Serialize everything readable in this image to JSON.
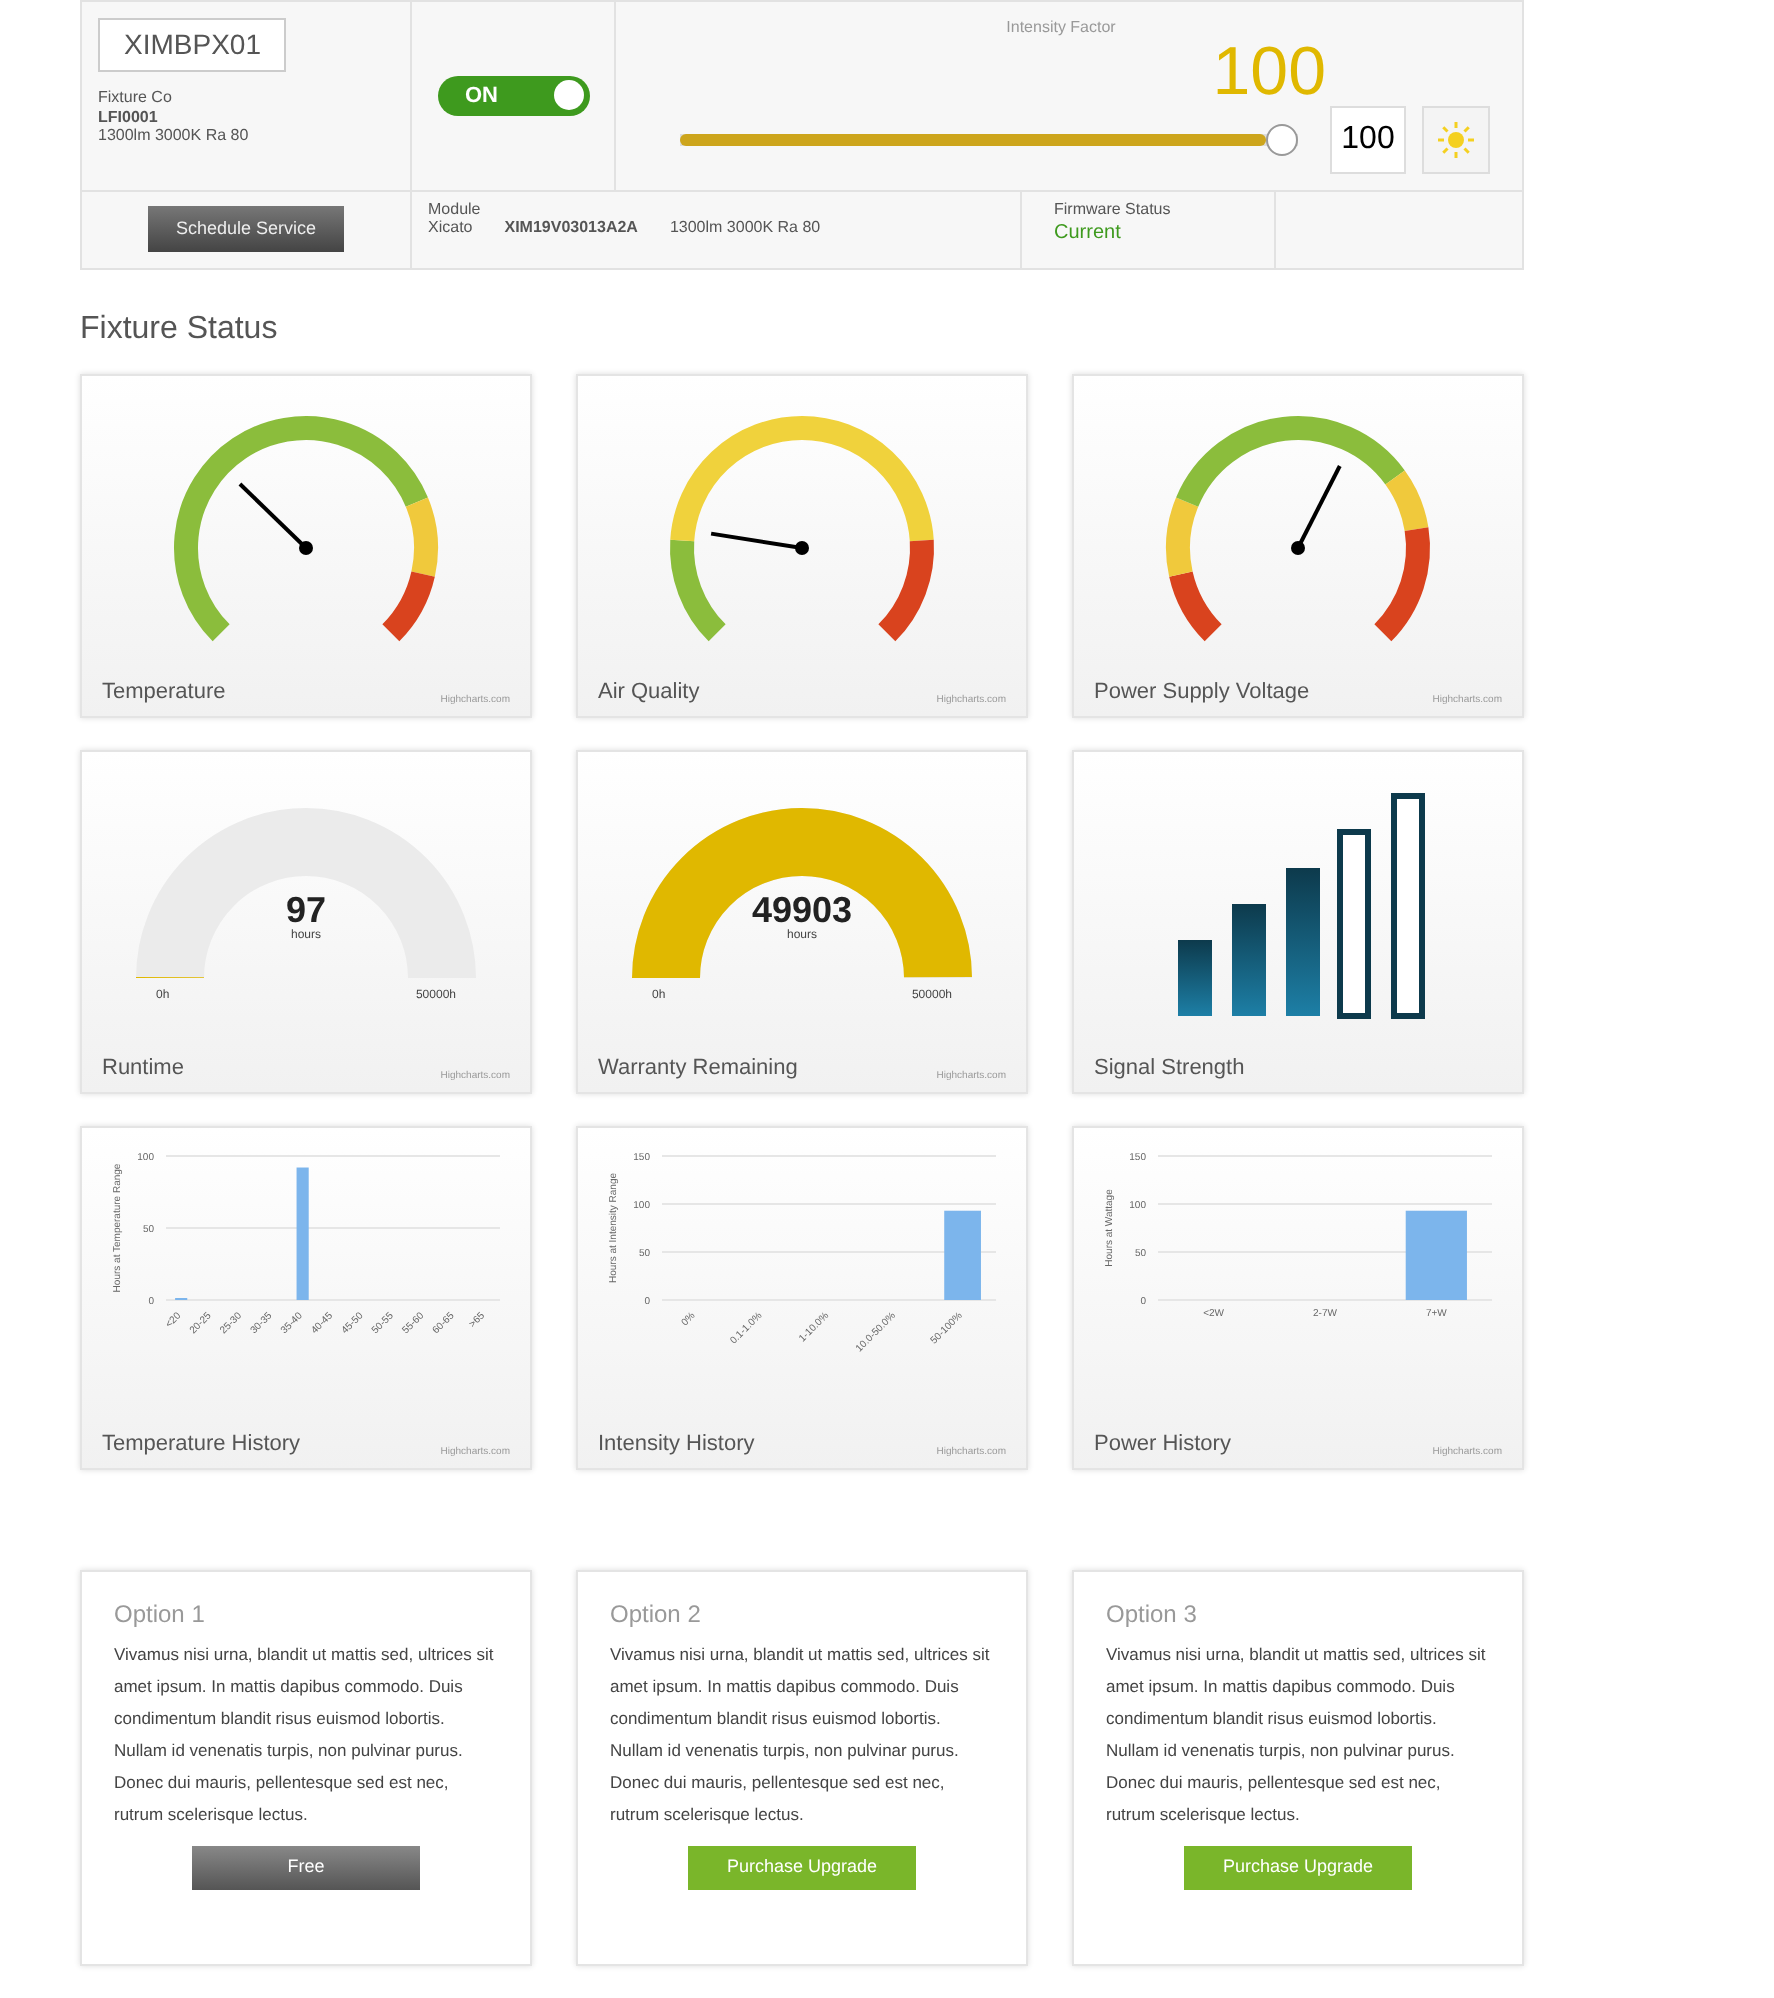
{
  "fixture": {
    "id": "XIMBPX01",
    "maker": "Fixture Co",
    "model": "LFI0001",
    "spec": "1300lm 3000K Ra 80",
    "power_on": true,
    "power_label": "ON",
    "intensity_label": "Intensity Factor",
    "intensity_big": "100",
    "intensity": {
      "level": 1.0
    },
    "intensity_value": "100",
    "schedule_button": "Schedule Service",
    "module_label": "Module",
    "module_maker": "Xicato",
    "module_id": "XIM19V03013A2A",
    "module_spec": "1300lm 3000K Ra 80",
    "firmware_label": "Firmware Status",
    "firmware_status": "Current"
  },
  "section_title": "Fixture Status",
  "gauges": [
    {
      "kind": "dial",
      "title": "Temperature",
      "credit": "Highcharts.com"
    },
    {
      "kind": "dial",
      "title": "Air Quality",
      "credit": "Highcharts.com"
    },
    {
      "kind": "dial",
      "title": "Power Supply Voltage",
      "credit": "Highcharts.com"
    },
    {
      "kind": "solid",
      "title": "Runtime",
      "value": "97",
      "unit": "hours",
      "min": "0h",
      "max": "50000h",
      "credit": "Highcharts.com"
    },
    {
      "kind": "solid",
      "title": "Warranty Remaining",
      "value": "49903",
      "unit": "hours",
      "min": "0h",
      "max": "50000h",
      "credit": "Highcharts.com"
    },
    {
      "kind": "signal",
      "title": "Signal Strength",
      "bars": [
        {
          "on": true
        },
        {
          "on": true
        },
        {
          "on": true
        },
        {
          "on": false
        },
        {
          "on": false
        }
      ]
    }
  ],
  "histories": [
    {
      "title": "Temperature History",
      "credit": "Highcharts.com",
      "chart_data": {
        "type": "bar",
        "ylabel": "Hours at Temperature Range",
        "categories": [
          "<20",
          "20-25",
          "25-30",
          "30-35",
          "35-40",
          "40-45",
          "45-50",
          "50-55",
          "55-60",
          "60-65",
          ">65"
        ],
        "series": [
          {
            "color": "#7cb5ec",
            "values": [
              1,
              0,
              0,
              0,
              92,
              0,
              0,
              0,
              0,
              0,
              0
            ]
          }
        ],
        "ylim": [
          0,
          100
        ],
        "yticks": [
          0,
          50,
          100
        ]
      }
    },
    {
      "title": "Intensity History",
      "credit": "Highcharts.com",
      "chart_data": {
        "type": "bar",
        "ylabel": "Hours at Intensity Range",
        "categories": [
          "0%",
          "0.1-1.0%",
          "1-10.0%",
          "10.0-50.0%",
          "50-100%"
        ],
        "series": [
          {
            "color": "#7cb5ec",
            "values": [
              0,
              0,
              0,
              0,
              93
            ]
          }
        ],
        "ylim": [
          0,
          150
        ],
        "yticks": [
          0,
          50,
          100,
          150
        ]
      }
    },
    {
      "title": "Power History",
      "credit": "Highcharts.com",
      "chart_data": {
        "type": "bar",
        "ylabel": "Hours at Wattage",
        "categories": [
          "<2W",
          "2-7W",
          "7+W"
        ],
        "series": [
          {
            "color": "#7cb5ec",
            "values": [
              0,
              0,
              93
            ]
          }
        ],
        "ylim": [
          0,
          150
        ],
        "yticks": [
          0,
          50,
          100,
          150
        ]
      }
    }
  ],
  "options": [
    {
      "title": "Option 1",
      "text": "Vivamus nisi urna, blandit ut mattis sed, ultrices sit amet ipsum. In mattis dapibus commodo. Duis condimentum blandit risus euismod lobortis. Nullam id venenatis turpis, non pulvinar purus. Donec dui mauris, pellentesque sed est nec, rutrum scelerisque lectus.",
      "button": "Free",
      "kind": "free"
    },
    {
      "title": "Option 2",
      "text": "Vivamus nisi urna, blandit ut mattis sed, ultrices sit amet ipsum. In mattis dapibus commodo. Duis condimentum blandit risus euismod lobortis. Nullam id venenatis turpis, non pulvinar purus. Donec dui mauris, pellentesque sed est nec, rutrum scelerisque lectus.",
      "button": "Purchase Upgrade",
      "kind": "upgrade"
    },
    {
      "title": "Option 3",
      "text": "Vivamus nisi urna, blandit ut mattis sed, ultrices sit amet ipsum. In mattis dapibus commodo. Duis condimentum blandit risus euismod lobortis. Nullam id venenatis turpis, non pulvinar purus. Donec dui mauris, pellentesque sed est nec, rutrum scelerisque lectus.",
      "button": "Purchase Upgrade",
      "kind": "upgrade"
    }
  ]
}
